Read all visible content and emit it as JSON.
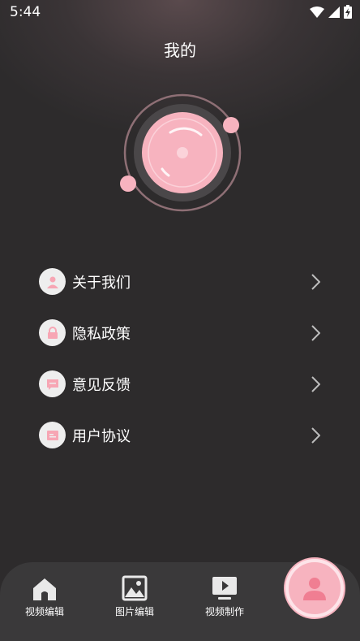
{
  "status_bar": {
    "time": "5:44"
  },
  "page": {
    "title": "我的"
  },
  "menu": {
    "items": [
      {
        "label": "关于我们",
        "icon": "person-icon"
      },
      {
        "label": "隐私政策",
        "icon": "lock-icon"
      },
      {
        "label": "意见反馈",
        "icon": "chat-icon"
      },
      {
        "label": "用户协议",
        "icon": "document-icon"
      }
    ]
  },
  "tab_bar": {
    "tabs": [
      {
        "label": "视频编辑",
        "icon": "home-icon"
      },
      {
        "label": "图片编辑",
        "icon": "image-icon"
      },
      {
        "label": "视频制作",
        "icon": "play-icon"
      }
    ],
    "active_icon": "profile-icon"
  },
  "colors": {
    "accent": "#f7b3bf",
    "background": "#2c2a2b",
    "tab_bar": "#3a393a"
  }
}
